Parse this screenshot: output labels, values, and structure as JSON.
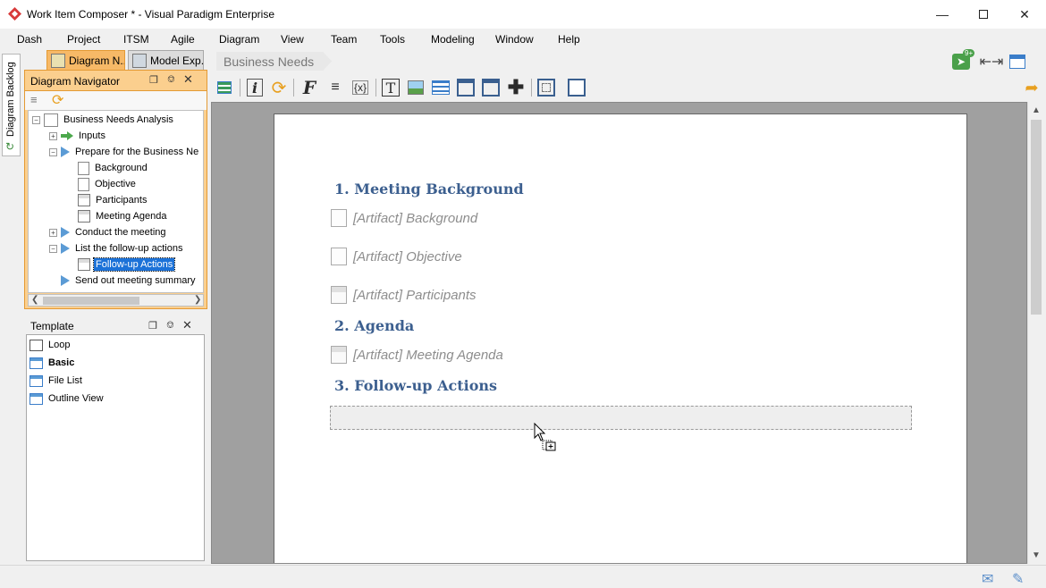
{
  "window": {
    "title": "Work Item Composer * - Visual Paradigm Enterprise",
    "minimize_icon": "minimize-icon",
    "maximize_icon": "maximize-icon",
    "close_icon": "close-icon"
  },
  "menu": {
    "items": [
      "Dash",
      "Project",
      "ITSM",
      "Agile",
      "Diagram",
      "View",
      "Team",
      "Tools",
      "Modeling",
      "Window",
      "Help"
    ]
  },
  "left_strip": {
    "backlog_tab": "Diagram Backlog"
  },
  "tabs": [
    {
      "label": "Diagram N..",
      "active": true
    },
    {
      "label": "Model Exp..",
      "active": false
    }
  ],
  "navigator": {
    "title": "Diagram Navigator",
    "tree": [
      {
        "label": "Business Needs Analysis",
        "icon": "document-icon",
        "level": 0,
        "expander": "-"
      },
      {
        "label": "Inputs",
        "icon": "arrow-right-icon",
        "level": 1,
        "expander": "+"
      },
      {
        "label": "Prepare for the Business Ne",
        "icon": "play-icon",
        "level": 1,
        "expander": "-"
      },
      {
        "label": "Background",
        "icon": "document-icon",
        "level": 2
      },
      {
        "label": "Objective",
        "icon": "document-icon",
        "level": 2
      },
      {
        "label": "Participants",
        "icon": "table-icon",
        "level": 2
      },
      {
        "label": "Meeting Agenda",
        "icon": "table-icon",
        "level": 2
      },
      {
        "label": "Conduct the meeting",
        "icon": "play-icon",
        "level": 1,
        "expander": "+"
      },
      {
        "label": "List the follow-up actions",
        "icon": "play-icon",
        "level": 1,
        "expander": "-"
      },
      {
        "label": "Follow-up Actions",
        "icon": "table-icon",
        "level": 2,
        "selected": true
      },
      {
        "label": "Send out meeting summary",
        "icon": "play-icon",
        "level": 1
      }
    ]
  },
  "template_panel": {
    "title": "Template",
    "items": [
      {
        "label": "Loop",
        "bold": false
      },
      {
        "label": "Basic",
        "bold": true
      },
      {
        "label": "File List",
        "bold": false
      },
      {
        "label": "Outline View",
        "bold": false
      }
    ]
  },
  "breadcrumb": "Business Needs",
  "document": {
    "sections": [
      {
        "heading": "1. Meeting Background"
      },
      {
        "heading": "2. Agenda"
      },
      {
        "heading": "3. Follow-up Actions"
      }
    ],
    "artifacts": [
      {
        "text": "[Artifact] Background",
        "icon": "document-icon"
      },
      {
        "text": "[Artifact] Objective",
        "icon": "document-icon"
      },
      {
        "text": "[Artifact] Participants",
        "icon": "table-icon"
      },
      {
        "text": "[Artifact] Meeting Agenda",
        "icon": "table-icon"
      }
    ]
  },
  "notification_badge": "9+",
  "colors": {
    "accent": "#f7b967",
    "heading": "#3c5f8f",
    "selection": "#1c72d8"
  }
}
